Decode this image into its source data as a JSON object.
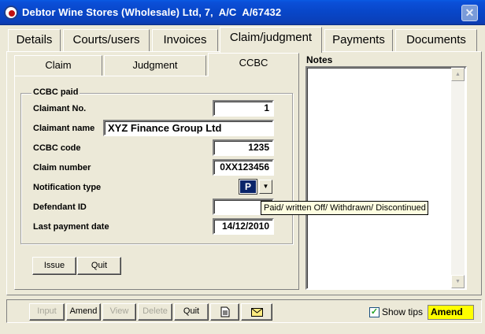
{
  "window": {
    "title": "Debtor Wine Stores (Wholesale) Ltd, 7,  A/C  A/67432",
    "close_label": "✕"
  },
  "main_tabs": [
    {
      "label": "Details"
    },
    {
      "label": "Courts/users"
    },
    {
      "label": "Invoices"
    },
    {
      "label": "Claim/judgment",
      "active": true
    },
    {
      "label": "Payments"
    },
    {
      "label": "Documents"
    }
  ],
  "sub_tabs": [
    {
      "label": "Claim"
    },
    {
      "label": "Judgment"
    },
    {
      "label": "CCBC",
      "active": true
    }
  ],
  "ccbc": {
    "group_title": "CCBC paid",
    "fields": {
      "claimant_no": {
        "label": "Claimant No.",
        "value": "1"
      },
      "claimant_name": {
        "label": "Claimant name",
        "value": "XYZ Finance Group Ltd"
      },
      "ccbc_code": {
        "label": "CCBC code",
        "value": "1235"
      },
      "claim_number": {
        "label": "Claim number",
        "value": "0XX123456"
      },
      "notification_type": {
        "label": "Notification type",
        "value": "P"
      },
      "defendant_id": {
        "label": "Defendant ID",
        "value": ""
      },
      "last_payment_date": {
        "label": "Last payment date",
        "value": "14/12/2010"
      }
    },
    "tooltip": "Paid/ written Off/ Withdrawn/ Discontinued",
    "issue_label": "Issue",
    "quit_label": "Quit"
  },
  "notes": {
    "label": "Notes",
    "value": ""
  },
  "toolbar": {
    "input_label": "Input",
    "amend_label": "Amend",
    "view_label": "View",
    "delete_label": "Delete",
    "quit_label": "Quit",
    "document_icon": "document-icon",
    "email_icon": "envelope-icon"
  },
  "status": {
    "show_tips_label": "Show tips",
    "show_tips_checked": true,
    "mode": "Amend",
    "mode_color": "#ffff00"
  }
}
